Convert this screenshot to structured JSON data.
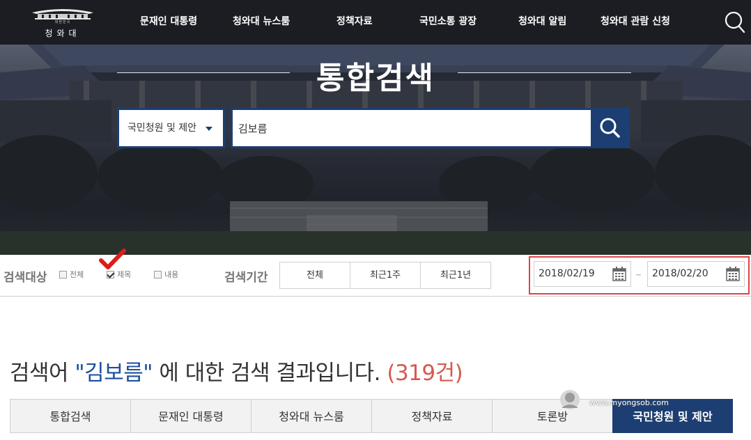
{
  "header": {
    "logo_small": "대한민국",
    "logo_name": "청와대",
    "nav": [
      {
        "label": "문재인 대통령"
      },
      {
        "label": "청와대 뉴스룸"
      },
      {
        "label": "정책자료"
      },
      {
        "label": "국민소통 광장"
      },
      {
        "label": "청와대 알림"
      },
      {
        "label": "청와대 관람 신청"
      }
    ],
    "search_icon": "search-icon"
  },
  "hero": {
    "title": "통합검색",
    "category_select": "국민청원 및 제안",
    "query": "김보름",
    "accent_color": "#1c3e72"
  },
  "filters": {
    "target_label": "검색대상",
    "targets": [
      {
        "label": "전체",
        "checked": false
      },
      {
        "label": "제목",
        "checked": true
      },
      {
        "label": "내용",
        "checked": false
      }
    ],
    "period_label": "검색기간",
    "periods": [
      "전체",
      "최근1주",
      "최근1년"
    ],
    "date_from": "2018/02/19",
    "date_sep": "~",
    "date_to": "2018/02/20"
  },
  "results": {
    "prefix": "검색어",
    "query_quoted": "\"김보름\"",
    "middle": "에 대한 검색 결과입니다.",
    "count": "(319건)",
    "tabs": [
      {
        "label": "통합검색",
        "active": false
      },
      {
        "label": "문재인 대통령",
        "active": false
      },
      {
        "label": "청와대 뉴스룸",
        "active": false
      },
      {
        "label": "정책자료",
        "active": false
      },
      {
        "label": "토론방",
        "active": false
      },
      {
        "label": "국민청원 및 제안",
        "active": true
      }
    ]
  },
  "watermark": {
    "text": "www.myongsob.com"
  }
}
